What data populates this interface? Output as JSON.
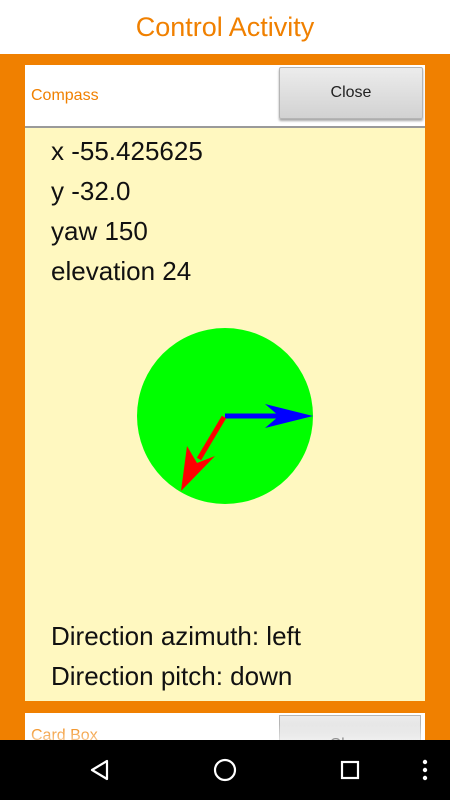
{
  "app": {
    "title": "Control Activity"
  },
  "compass_panel": {
    "title": "Compass",
    "close_label": "Close",
    "readouts": {
      "x": "x -55.425625",
      "y": "y -32.0",
      "yaw": "yaw  150",
      "elevation": "elevation  24"
    },
    "direction_azimuth": "Direction azimuth: left",
    "direction_pitch": "Direction pitch: down",
    "dial": {
      "fill_color": "#00ff00",
      "blue_arrow_color": "#0000ff",
      "red_arrow_color": "#ff0000",
      "blue_arrow_angle_deg": 90,
      "red_arrow_angle_deg": 210
    }
  },
  "next_panel": {
    "title": "Card Box",
    "close_label": "Close"
  },
  "nav": {
    "back": "back-icon",
    "home": "home-icon",
    "recents": "recents-icon",
    "more": "more-icon"
  }
}
